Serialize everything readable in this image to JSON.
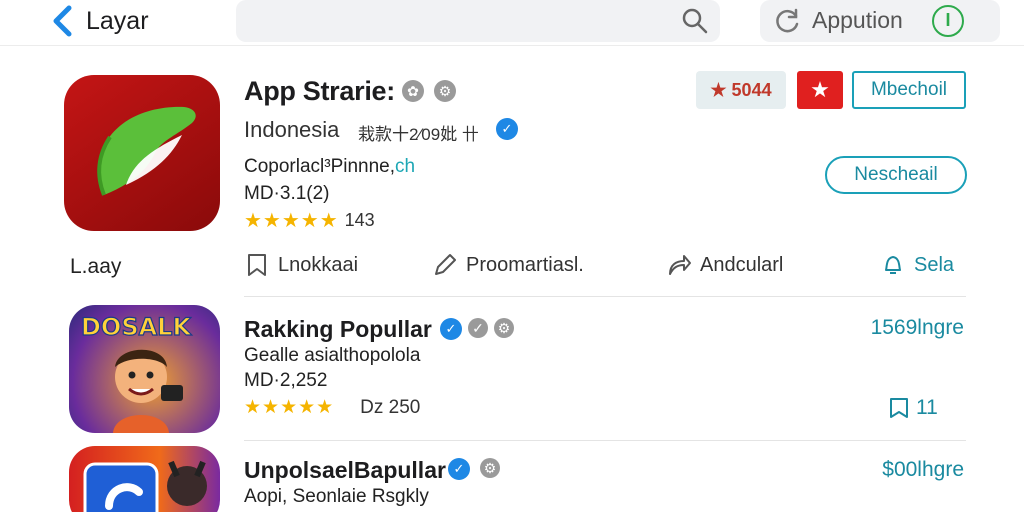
{
  "header": {
    "back_label": "Layar",
    "search_placeholder": "",
    "app_field_label": "Appution"
  },
  "featured": {
    "title": "App Strarie:",
    "region": "Indonesia",
    "region_sub": "栽款十2⁄09妣 卄",
    "developer_main": "Coporlacl³Pinnne,",
    "developer_tld": "ch",
    "meta": "MD·3.1(2)",
    "stars": "★★★★★",
    "rating_count": "143",
    "rating_badge": "★ 5044",
    "fav_label": "★",
    "square_button": "Mbechoil",
    "pill_button": "Nescheail",
    "name_label": "L.aay",
    "actions": {
      "lookup": "Lnokkaai",
      "promo": "Proomartiasl.",
      "share": "Andcularl",
      "sale": "Sela"
    }
  },
  "list": [
    {
      "icon_text": "DOSALK",
      "title": "Rakking Popullar",
      "subtitle": "Gealle asialthopolola",
      "meta": "MD·2,252",
      "stars": "★★★★★",
      "size": "Dz 250",
      "price": "1569lngre",
      "save_count": "11"
    },
    {
      "title": "UnpolsaelBapullar",
      "subtitle": "Aopi, Seonlaie Rsgkly",
      "price": "$00lhgre"
    }
  ],
  "colors": {
    "accent": "#1a8aa0",
    "star": "#f5b400",
    "red": "#e0201f",
    "verified": "#1e88e5"
  }
}
